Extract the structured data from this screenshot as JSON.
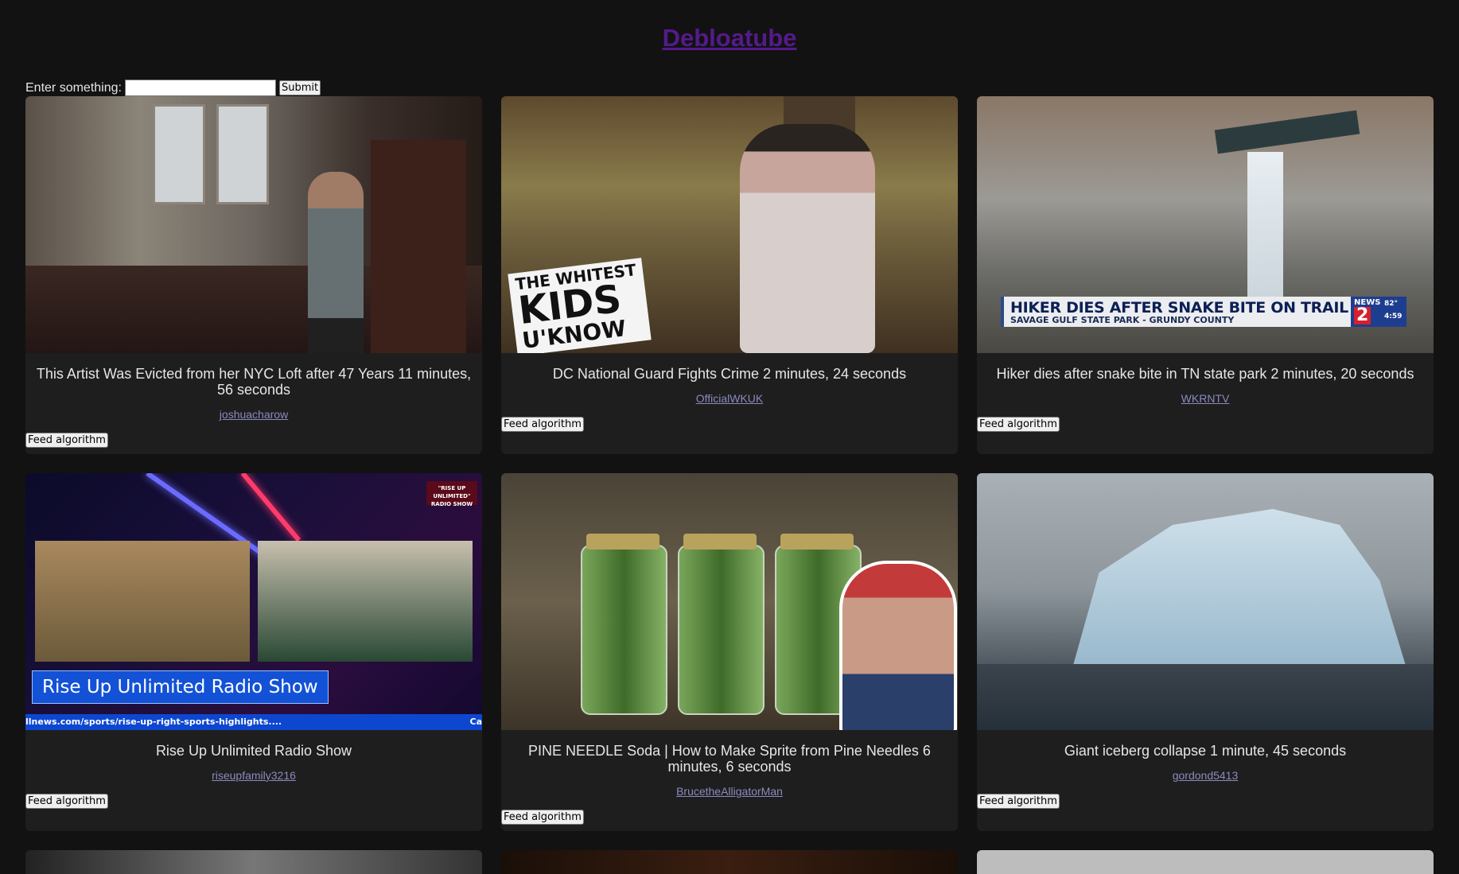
{
  "header": {
    "title": "Debloatube"
  },
  "search": {
    "label": "Enter something:",
    "value": "",
    "submit_label": "Submit"
  },
  "feed_button_label": "Feed algorithm",
  "thumb_text": {
    "v2_logo": [
      "THE WHITEST",
      "KIDS",
      "U'KNOW"
    ],
    "v3_headline": "HIKER DIES AFTER SNAKE BITE ON TRAIL",
    "v3_subline": "SAVAGE GULF STATE PARK - GRUNDY COUNTY",
    "v3_station": "NEWS",
    "v3_channel": "2",
    "v3_temp": "82°",
    "v3_time": "4:59",
    "v4_brand": "\"RISE UP UNLIMITED\" RADIO SHOW",
    "v4_lower_third": "Rise Up Unlimited Radio Show",
    "v4_ticker": "llnews.com/sports/rise-up-right-sports-highlights....",
    "v4_ticker_right": "Ca"
  },
  "videos": [
    {
      "title": "This Artist Was Evicted from her NYC Loft after 47 Years 11 minutes, 56 seconds",
      "channel": "joshuacharow"
    },
    {
      "title": "DC National Guard Fights Crime 2 minutes, 24 seconds",
      "channel": "OfficialWKUK"
    },
    {
      "title": "Hiker dies after snake bite in TN state park 2 minutes, 20 seconds",
      "channel": "WKRNTV"
    },
    {
      "title": "Rise Up Unlimited Radio Show",
      "channel": "riseupfamily3216"
    },
    {
      "title": "PINE NEEDLE Soda | How to Make Sprite from Pine Needles 6 minutes, 6 seconds",
      "channel": "BrucetheAlligatorMan"
    },
    {
      "title": "Giant iceberg collapse 1 minute, 45 seconds",
      "channel": "gordond5413"
    }
  ]
}
